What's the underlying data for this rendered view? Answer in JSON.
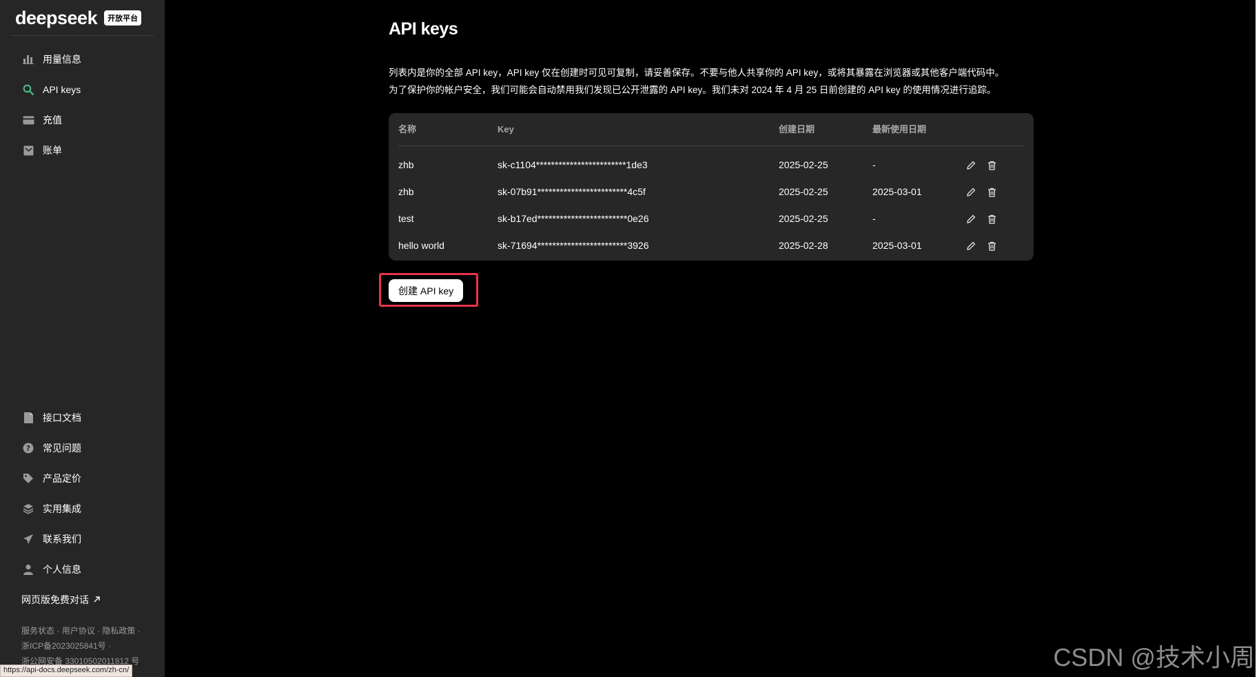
{
  "sidebar": {
    "logo_text": "deepseek",
    "logo_badge": "开放平台",
    "top_items": [
      {
        "label": "用量信息",
        "icon": "bar-chart-icon"
      },
      {
        "label": "API keys",
        "icon": "search-icon"
      },
      {
        "label": "充值",
        "icon": "card-icon"
      },
      {
        "label": "账单",
        "icon": "bill-icon"
      }
    ],
    "bottom_items": [
      {
        "label": "接口文档",
        "icon": "document-icon"
      },
      {
        "label": "常见问题",
        "icon": "question-icon"
      },
      {
        "label": "产品定价",
        "icon": "tag-icon"
      },
      {
        "label": "实用集成",
        "icon": "layers-icon"
      },
      {
        "label": "联系我们",
        "icon": "send-icon"
      },
      {
        "label": "个人信息",
        "icon": "user-icon"
      }
    ],
    "web_chat": "网页版免费对话",
    "footer": {
      "status": "服务状态",
      "agreement": "用户协议",
      "privacy": "隐私政策",
      "icp": "浙ICP备2023025841号",
      "police": "浙公网安备 33010502011812 号"
    },
    "status_url": "https://api-docs.deepseek.com/zh-cn/"
  },
  "main": {
    "title": "API keys",
    "desc_line1": "列表内是你的全部 API key，API key 仅在创建时可见可复制，请妥善保存。不要与他人共享你的 API key，或将其暴露在浏览器或其他客户端代码中。",
    "desc_line2": "为了保护你的帐户安全，我们可能会自动禁用我们发现已公开泄露的 API key。我们未对 2024 年 4 月 25 日前创建的 API key 的使用情况进行追踪。",
    "table": {
      "headers": {
        "name": "名称",
        "key": "Key",
        "created": "创建日期",
        "last_used": "最新使用日期"
      },
      "rows": [
        {
          "name": "zhb",
          "key": "sk-c1104************************1de3",
          "created": "2025-02-25",
          "last_used": "-"
        },
        {
          "name": "zhb",
          "key": "sk-07b91************************4c5f",
          "created": "2025-02-25",
          "last_used": "2025-03-01"
        },
        {
          "name": "test",
          "key": "sk-b17ed************************0e26",
          "created": "2025-02-25",
          "last_used": "-"
        },
        {
          "name": "hello world",
          "key": "sk-71694************************3926",
          "created": "2025-02-28",
          "last_used": "2025-03-01"
        }
      ]
    },
    "create_button": "创建 API key"
  },
  "watermark": "CSDN @技术小周",
  "colors": {
    "sidebar_bg": "#262626",
    "main_bg": "#000000",
    "card_bg": "#272727",
    "accent_green": "#4cc38a",
    "highlight_red": "#e8334a"
  }
}
